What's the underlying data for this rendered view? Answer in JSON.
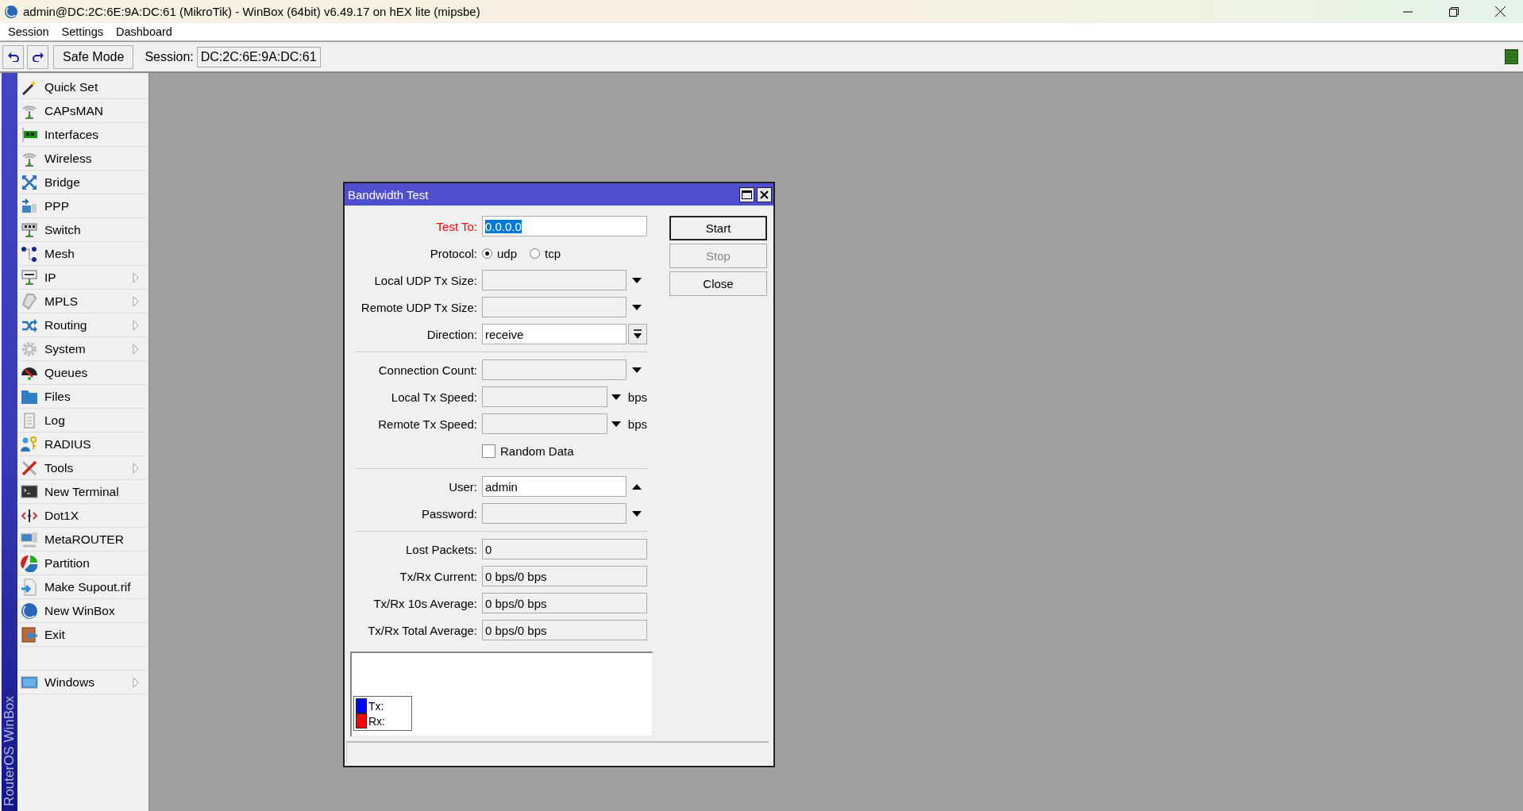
{
  "window": {
    "title": "admin@DC:2C:6E:9A:DC:61 (MikroTik) - WinBox (64bit) v6.49.17 on hEX lite (mipsbe)"
  },
  "menu": [
    "Session",
    "Settings",
    "Dashboard"
  ],
  "toolbar": {
    "safe_mode": "Safe Mode",
    "session_label": "Session:",
    "session_value": "DC:2C:6E:9A:DC:61"
  },
  "sidebar": {
    "brand": "RouterOS WinBox",
    "items": [
      {
        "kind": "item",
        "label": "Quick Set",
        "submenu": false
      },
      {
        "kind": "item",
        "label": "CAPsMAN",
        "submenu": false
      },
      {
        "kind": "item",
        "label": "Interfaces",
        "submenu": false
      },
      {
        "kind": "item",
        "label": "Wireless",
        "submenu": false
      },
      {
        "kind": "item",
        "label": "Bridge",
        "submenu": false
      },
      {
        "kind": "item",
        "label": "PPP",
        "submenu": false
      },
      {
        "kind": "item",
        "label": "Switch",
        "submenu": false
      },
      {
        "kind": "item",
        "label": "Mesh",
        "submenu": false
      },
      {
        "kind": "item",
        "label": "IP",
        "submenu": true
      },
      {
        "kind": "item",
        "label": "MPLS",
        "submenu": true
      },
      {
        "kind": "item",
        "label": "Routing",
        "submenu": true
      },
      {
        "kind": "item",
        "label": "System",
        "submenu": true
      },
      {
        "kind": "item",
        "label": "Queues",
        "submenu": false
      },
      {
        "kind": "item",
        "label": "Files",
        "submenu": false
      },
      {
        "kind": "item",
        "label": "Log",
        "submenu": false
      },
      {
        "kind": "item",
        "label": "RADIUS",
        "submenu": false
      },
      {
        "kind": "item",
        "label": "Tools",
        "submenu": true
      },
      {
        "kind": "item",
        "label": "New Terminal",
        "submenu": false
      },
      {
        "kind": "item",
        "label": "Dot1X",
        "submenu": false
      },
      {
        "kind": "item",
        "label": "MetaROUTER",
        "submenu": false
      },
      {
        "kind": "item",
        "label": "Partition",
        "submenu": false
      },
      {
        "kind": "item",
        "label": "Make Supout.rif",
        "submenu": false
      },
      {
        "kind": "item",
        "label": "New WinBox",
        "submenu": false
      },
      {
        "kind": "item",
        "label": "Exit",
        "submenu": false
      },
      {
        "kind": "spacer"
      },
      {
        "kind": "item",
        "label": "Windows",
        "submenu": true
      }
    ]
  },
  "dialog": {
    "title": "Bandwidth Test",
    "rows": [
      {
        "kind": "text",
        "label": "Test To:",
        "required": true,
        "value": "0.0.0.0",
        "highlighted": true
      },
      {
        "kind": "radio",
        "label": "Protocol:",
        "required": false,
        "options": [
          {
            "label": "udp",
            "selected": true
          },
          {
            "label": "tcp",
            "selected": false
          }
        ]
      },
      {
        "kind": "combo",
        "label": "Local UDP Tx Size:",
        "required": false,
        "enabled": false,
        "expanded": false
      },
      {
        "kind": "combo",
        "label": "Remote UDP Tx Size:",
        "required": false,
        "enabled": false,
        "expanded": false
      },
      {
        "kind": "select",
        "label": "Direction:",
        "required": false,
        "value": "receive"
      },
      {
        "kind": "separator"
      },
      {
        "kind": "combo",
        "label": "Connection Count:",
        "required": false,
        "enabled": false,
        "expanded": false
      },
      {
        "kind": "combo",
        "label": "Local Tx Speed:",
        "required": false,
        "enabled": false,
        "expanded": false,
        "unit": "bps"
      },
      {
        "kind": "combo",
        "label": "Remote Tx Speed:",
        "required": false,
        "enabled": false,
        "expanded": false,
        "unit": "bps"
      },
      {
        "kind": "checkbox",
        "label": "Random Data",
        "checked": false
      },
      {
        "kind": "separator"
      },
      {
        "kind": "combo",
        "label": "User:",
        "required": false,
        "enabled": true,
        "expanded": true,
        "value": "admin"
      },
      {
        "kind": "combo",
        "label": "Password:",
        "required": false,
        "enabled": false,
        "expanded": false
      },
      {
        "kind": "separator"
      },
      {
        "kind": "readonly",
        "label": "Lost Packets:",
        "required": false,
        "value": "0"
      },
      {
        "kind": "readonly",
        "label": "Tx/Rx Current:",
        "required": false,
        "value": "0 bps/0 bps"
      },
      {
        "kind": "readonly",
        "label": "Tx/Rx 10s Average:",
        "required": false,
        "value": "0 bps/0 bps"
      },
      {
        "kind": "readonly",
        "label": "Tx/Rx Total Average:",
        "required": false,
        "value": "0 bps/0 bps"
      }
    ],
    "buttons": [
      {
        "label": "Start",
        "default": true,
        "disabled": false
      },
      {
        "label": "Stop",
        "default": false,
        "disabled": true
      },
      {
        "label": "Close",
        "default": false,
        "disabled": false
      }
    ],
    "legend": [
      {
        "label": "Tx:",
        "color": "#0000ff"
      },
      {
        "label": "Rx:",
        "color": "#ff0000"
      }
    ]
  }
}
